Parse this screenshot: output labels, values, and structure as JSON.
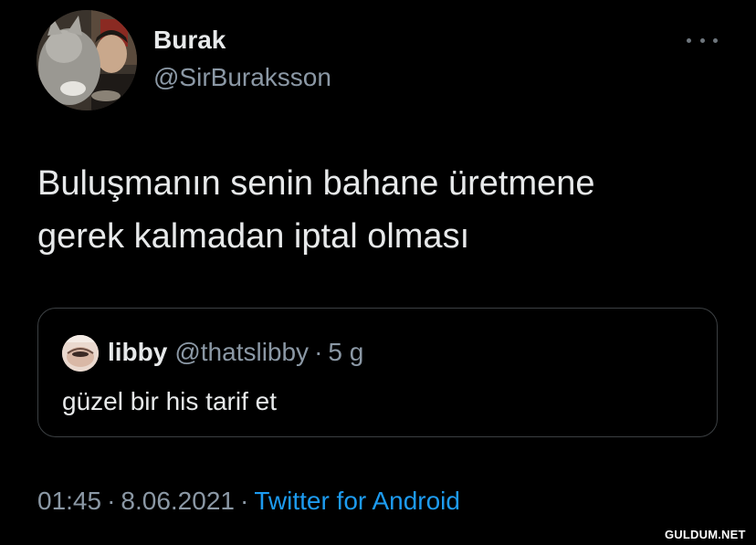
{
  "tweet": {
    "display_name": "Burak",
    "handle": "@SirBuraksson",
    "text_lines": [
      "Buluşmanın senin bahane üretmene",
      "gerek kalmadan iptal olması"
    ],
    "avatar_icon": "profile-photo-man-with-cat",
    "more_icon": "more-dots-icon"
  },
  "quote": {
    "name": "libby",
    "handle": "@thatslibby",
    "separator": "·",
    "time": "5 g",
    "text": "güzel bir his tarif et",
    "avatar_icon": "profile-photo-libby"
  },
  "meta": {
    "time": "01:45",
    "separator": "·",
    "date": "8.06.2021",
    "client": "Twitter for Android"
  },
  "watermark": "GULDUM.NET",
  "colors": {
    "background": "#000000",
    "primary_text": "#e7e9ea",
    "secondary_text": "#8b98a5",
    "link": "#1d9bf0",
    "border": "#3c4043"
  }
}
